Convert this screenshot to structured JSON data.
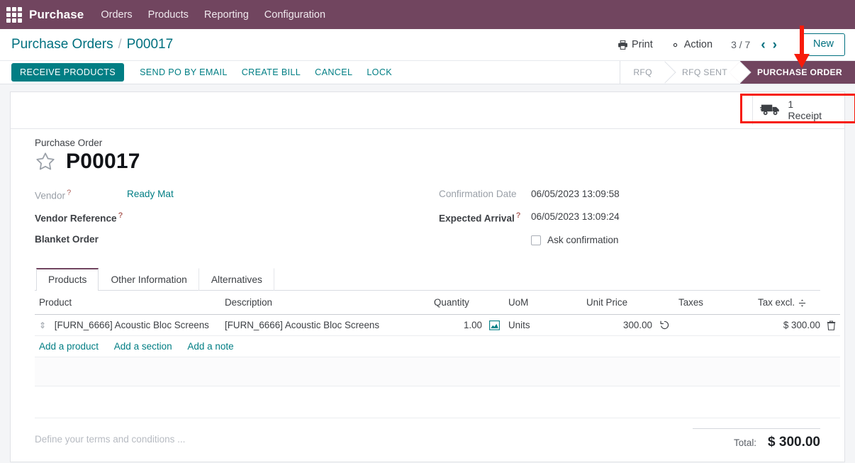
{
  "navbar": {
    "apps_icon": "apps-grid-icon",
    "brand": "Purchase",
    "menus": [
      "Orders",
      "Products",
      "Reporting",
      "Configuration"
    ]
  },
  "control_panel": {
    "breadcrumb_root": "Purchase Orders",
    "breadcrumb_separator": "/",
    "breadcrumb_current": "P00017",
    "print_label": "Print",
    "print_icon": "printer-icon",
    "action_label": "Action",
    "action_icon": "gear-icon",
    "pager": "3 / 7",
    "prev_icon": "chevron-left-icon",
    "next_icon": "chevron-right-icon",
    "new_label": "New"
  },
  "statusbar": {
    "buttons": [
      {
        "label": "RECEIVE PRODUCTS",
        "primary": true
      },
      {
        "label": "SEND PO BY EMAIL",
        "primary": false
      },
      {
        "label": "CREATE BILL",
        "primary": false
      },
      {
        "label": "CANCEL",
        "primary": false
      },
      {
        "label": "LOCK",
        "primary": false
      }
    ],
    "stages": [
      {
        "label": "RFQ",
        "active": false
      },
      {
        "label": "RFQ SENT",
        "active": false
      },
      {
        "label": "PURCHASE ORDER",
        "active": true
      }
    ]
  },
  "smart_buttons": [
    {
      "icon": "truck-icon",
      "count": "1",
      "label": "Receipt"
    }
  ],
  "form": {
    "title_label": "Purchase Order",
    "star_icon": "star-icon",
    "title": "P00017",
    "left_fields": [
      {
        "label": "Vendor",
        "help": "?",
        "value": "Ready Mat",
        "muted_label": true,
        "link": true
      },
      {
        "label": "Vendor Reference",
        "help": "?",
        "value": "",
        "muted_label": false,
        "link": false
      },
      {
        "label": "Blanket Order",
        "help": "",
        "value": "",
        "muted_label": false,
        "link": false
      }
    ],
    "right_fields": [
      {
        "label": "Confirmation Date",
        "help": "",
        "value": "06/05/2023 13:09:58",
        "muted_label": true
      },
      {
        "label": "Expected Arrival",
        "help": "?",
        "value": "06/05/2023 13:09:24",
        "muted_label": false
      }
    ],
    "checkbox": {
      "label": "Ask confirmation",
      "checked": false
    }
  },
  "tabs": [
    {
      "label": "Products",
      "active": true
    },
    {
      "label": "Other Information",
      "active": false
    },
    {
      "label": "Alternatives",
      "active": false
    }
  ],
  "lines_table": {
    "columns": [
      "Product",
      "Description",
      "Quantity",
      "UoM",
      "Unit Price",
      "Taxes",
      "Tax excl."
    ],
    "optional_columns_icon": "optional-columns-toggle-icon",
    "rows": [
      {
        "handle_icon": "drag-handle-icon",
        "product": "[FURN_6666] Acoustic Bloc Screens",
        "description": "[FURN_6666] Acoustic Bloc Screens",
        "quantity": "1.00",
        "quantity_icon": "forecast-chart-icon",
        "uom": "Units",
        "unit_price": "300.00",
        "unit_price_icon": "history-reset-icon",
        "taxes": "",
        "tax_excl": "$ 300.00",
        "delete_icon": "trash-icon"
      }
    ],
    "add_links": [
      "Add a product",
      "Add a section",
      "Add a note"
    ]
  },
  "footer": {
    "terms_placeholder": "Define your terms and conditions ...",
    "total_label": "Total:",
    "total_value": "$ 300.00"
  },
  "annotations": {
    "arrow_color": "#f71b0b",
    "highlight_color": "#f71b0b",
    "highlight_target": "Receipt smart button",
    "arrow_target": "New button"
  },
  "colors": {
    "brand_purple": "#71455f",
    "accent_teal": "#017e84",
    "link_teal": "#00707f"
  }
}
